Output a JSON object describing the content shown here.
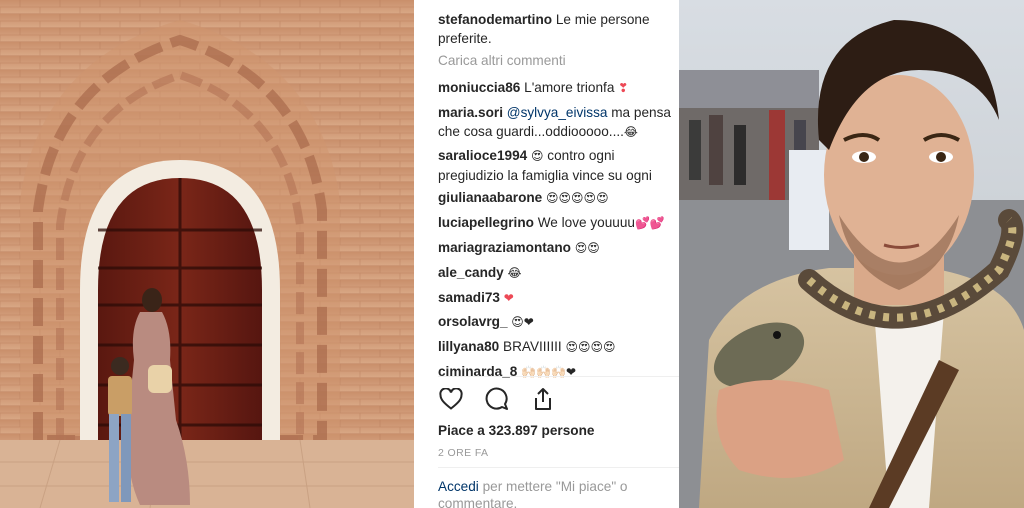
{
  "caption": {
    "username": "stefanodemartino",
    "text": "Le mie persone preferite."
  },
  "load_more": "Carica altri commenti",
  "comments": [
    {
      "user": "moniuccia86",
      "pre": "",
      "mention": "",
      "text": "L'amore trionfa",
      "emoji": "❣"
    },
    {
      "user": "maria.sori",
      "pre": "",
      "mention": "@sylvya_eivissa",
      "text": "ma pensa che cosa guardi...oddiooooo....",
      "emoji": "😂"
    },
    {
      "user": "saralioce1994",
      "pre": "😍",
      "mention": "",
      "text": "contro ogni pregiudizio la famiglia vince su ogni cosa.",
      "emoji": ""
    },
    {
      "user": "giulianaabarone",
      "pre": "",
      "mention": "",
      "text": "",
      "emoji": "😍😍😍😍😍"
    },
    {
      "user": "luciapellegrino",
      "pre": "",
      "mention": "",
      "text": "We love youuuu",
      "emoji": "💕💕"
    },
    {
      "user": "mariagraziamontano",
      "pre": "",
      "mention": "",
      "text": "",
      "emoji": "😍😍"
    },
    {
      "user": "ale_candy",
      "pre": "",
      "mention": "",
      "text": "",
      "emoji": "😂"
    },
    {
      "user": "samadi73",
      "pre": "",
      "mention": "",
      "text": "",
      "emoji": "❤"
    },
    {
      "user": "orsolavrg_",
      "pre": "",
      "mention": "",
      "text": "",
      "emoji": "😍❤"
    },
    {
      "user": "lillyana80",
      "pre": "",
      "mention": "",
      "text": "BRAVIIIIII",
      "emoji": "😍😍😍😍"
    },
    {
      "user": "ciminarda_8",
      "pre": "",
      "mention": "",
      "text": "",
      "emoji": "🙌🏻🙌🏻🙌🏻❤"
    }
  ],
  "likes": "Piace a 323.897 persone",
  "time_ago": "2 ORE FA",
  "login": {
    "link": "Accedi",
    "text": "per mettere \"Mi piace\" o commentare."
  },
  "icons": {
    "like": "heart-icon",
    "comment": "comment-icon",
    "share": "share-icon"
  },
  "colors": {
    "username": "#262626",
    "mention": "#003569",
    "muted": "#999999",
    "heart": "#ed4956"
  }
}
